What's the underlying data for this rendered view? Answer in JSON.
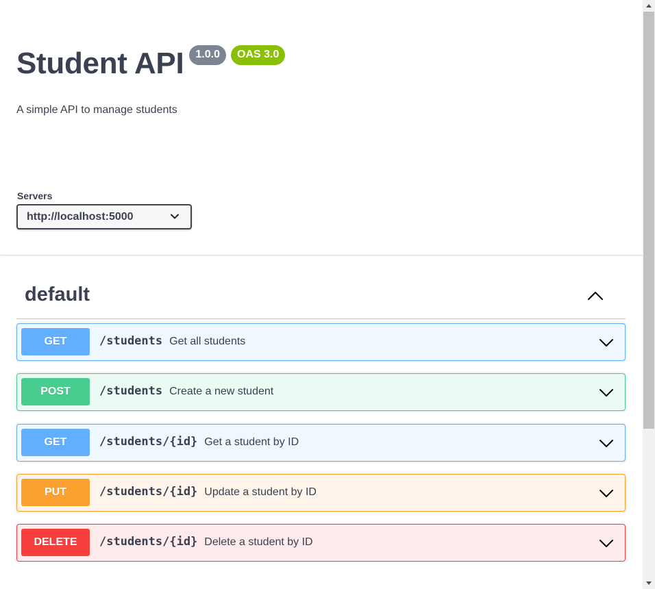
{
  "info": {
    "title": "Student API",
    "version": "1.0.0",
    "oas_badge": "OAS 3.0",
    "description": "A simple API to manage students"
  },
  "servers": {
    "label": "Servers",
    "selected": "http://localhost:5000"
  },
  "tag": {
    "name": "default",
    "expanded": true
  },
  "operations": [
    {
      "method": "GET",
      "path": "/students",
      "summary": "Get all students"
    },
    {
      "method": "POST",
      "path": "/students",
      "summary": "Create a new student"
    },
    {
      "method": "GET",
      "path": "/students/{id}",
      "summary": "Get a student by ID"
    },
    {
      "method": "PUT",
      "path": "/students/{id}",
      "summary": "Update a student by ID"
    },
    {
      "method": "DELETE",
      "path": "/students/{id}",
      "summary": "Delete a student by ID"
    }
  ],
  "colors": {
    "get": "#61affe",
    "post": "#49cc90",
    "put": "#fca130",
    "delete": "#f93e3e",
    "version_badge": "#7d8492",
    "oas_badge": "#89bf04",
    "text": "#3b4151"
  },
  "icons": {
    "select_arrow": "chevron-down-icon",
    "tag_toggle": "chevron-up-icon",
    "operation_expand": "chevron-down-icon"
  }
}
